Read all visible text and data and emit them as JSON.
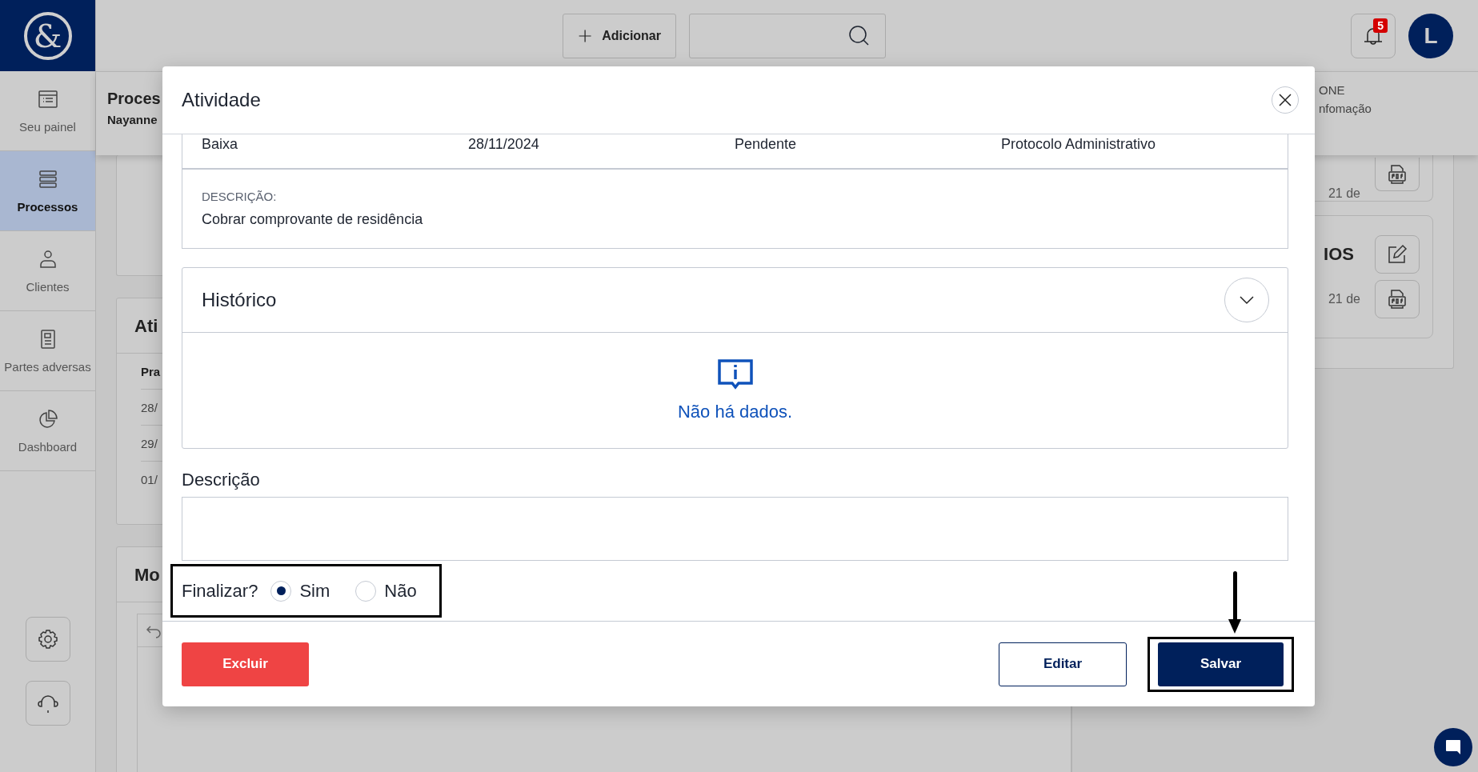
{
  "sidebar": {
    "logo": "&",
    "items": [
      {
        "kind": "list",
        "label": "Seu painel",
        "selected": false
      },
      {
        "kind": "stack",
        "label": "Processos",
        "selected": true
      },
      {
        "kind": "person",
        "label": "Clientes",
        "selected": false
      },
      {
        "kind": "doc",
        "label": "Partes adversas",
        "selected": false
      },
      {
        "kind": "pie",
        "label": "Dashboard",
        "selected": false
      }
    ]
  },
  "topbar": {
    "add_button": "Adicionar",
    "notification_count": "5",
    "avatar": "L"
  },
  "page": {
    "title": "Proces",
    "subtitle": "Nayanne",
    "info_1": "ONE",
    "info_2": "nfomação"
  },
  "activities_card": {
    "title": "Ati",
    "column_1": "Pra",
    "rows": [
      "28/",
      "29/",
      "01/"
    ]
  },
  "card_3": {
    "title": "Mo"
  },
  "right_cards": [
    {
      "date": "21 de"
    },
    {
      "title": "IOS",
      "date": "21 de"
    }
  ],
  "modal": {
    "title": "Atividade",
    "fields": [
      "Baixa",
      "28/11/2024",
      "Pendente",
      "Protocolo Administrativo"
    ],
    "description_label": "DESCRIÇÃO:",
    "description": "Cobrar comprovante de residência",
    "history": {
      "title": "Histórico",
      "empty_message": "Não há dados."
    },
    "notes_label": "Descrição",
    "finalize": {
      "label": "Finalizar?",
      "options": [
        {
          "label": "Sim",
          "selected": true
        },
        {
          "label": "Não",
          "selected": false
        }
      ]
    },
    "buttons": {
      "delete": "Excluir",
      "edit": "Editar",
      "save": "Salvar"
    }
  }
}
